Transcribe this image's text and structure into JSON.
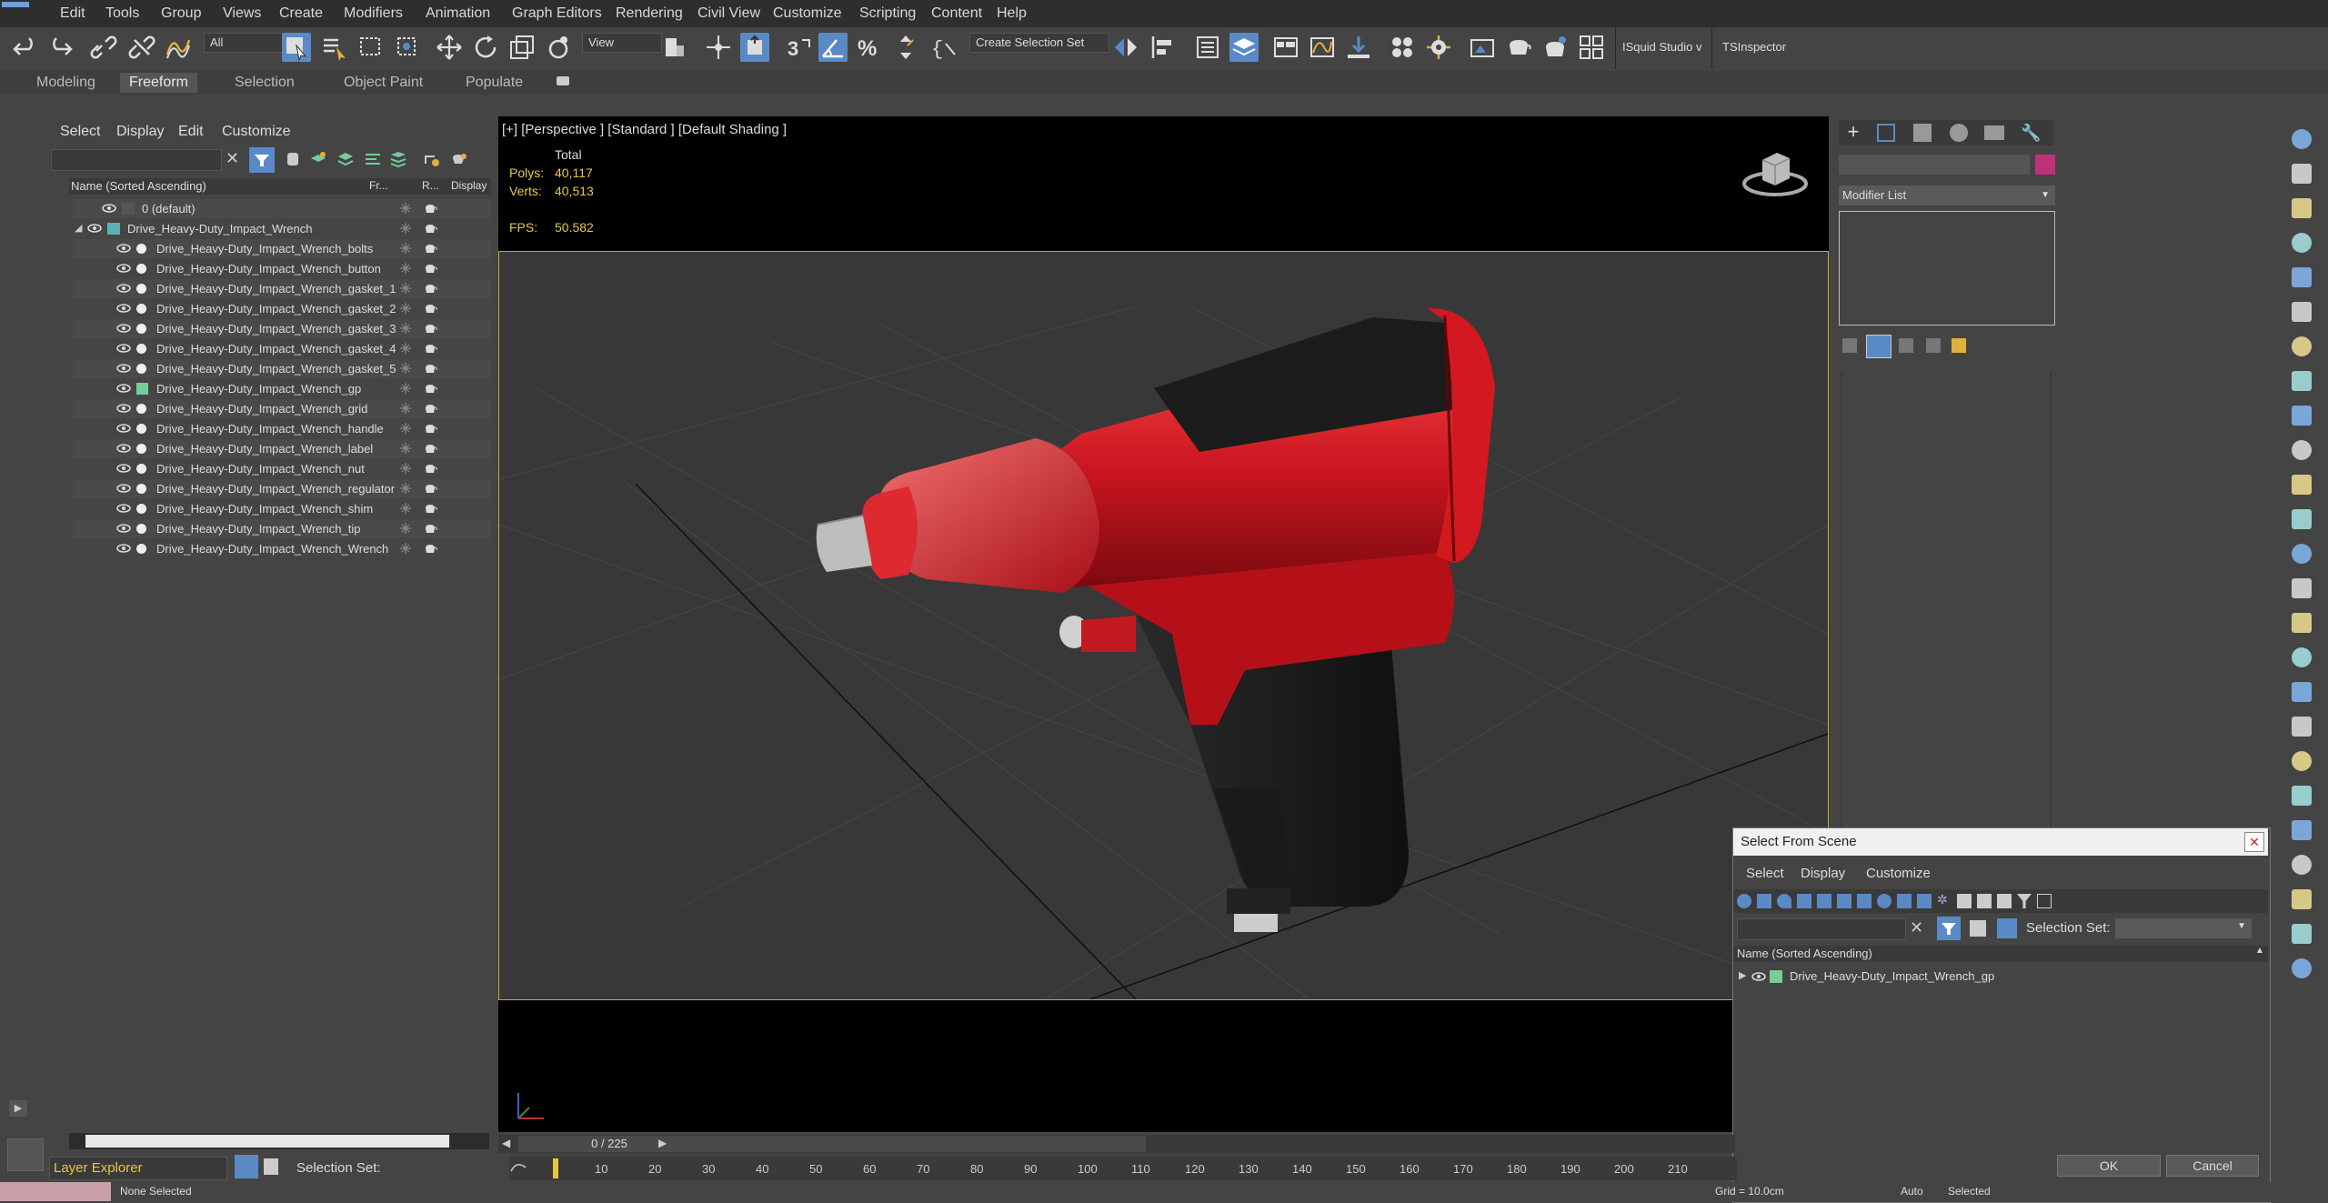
{
  "menubar": {
    "items": [
      "Edit",
      "Tools",
      "Group",
      "Views",
      "Create",
      "Modifiers",
      "Animation",
      "Graph Editors",
      "Rendering",
      "Civil View",
      "Customize",
      "Scripting",
      "Content",
      "Help"
    ]
  },
  "toolbar": {
    "filter_value": "All",
    "refcoord_value": "View",
    "selection_set": "Create Selection Set",
    "plugin_label_1": "ISquid Studio v",
    "plugin_label_2": "TSInspector"
  },
  "ribbon": {
    "tabs": [
      "Modeling",
      "Freeform",
      "Selection",
      "Object Paint",
      "Populate"
    ],
    "active_tab": "Freeform"
  },
  "scene_explorer": {
    "menu": [
      "Select",
      "Display",
      "Edit",
      "Customize"
    ],
    "col_name": "Name (Sorted Ascending)",
    "col_fr": "Fr...",
    "col_r": "R...",
    "col_display": "Display",
    "rows": [
      "0 (default)",
      "Drive_Heavy-Duty_Impact_Wrench",
      "Drive_Heavy-Duty_Impact_Wrench_bolts",
      "Drive_Heavy-Duty_Impact_Wrench_button",
      "Drive_Heavy-Duty_Impact_Wrench_gasket_1",
      "Drive_Heavy-Duty_Impact_Wrench_gasket_2",
      "Drive_Heavy-Duty_Impact_Wrench_gasket_3",
      "Drive_Heavy-Duty_Impact_Wrench_gasket_4",
      "Drive_Heavy-Duty_Impact_Wrench_gasket_5",
      "Drive_Heavy-Duty_Impact_Wrench_gp",
      "Drive_Heavy-Duty_Impact_Wrench_grid",
      "Drive_Heavy-Duty_Impact_Wrench_handle",
      "Drive_Heavy-Duty_Impact_Wrench_label",
      "Drive_Heavy-Duty_Impact_Wrench_nut",
      "Drive_Heavy-Duty_Impact_Wrench_regulator",
      "Drive_Heavy-Duty_Impact_Wrench_shim",
      "Drive_Heavy-Duty_Impact_Wrench_tip",
      "Drive_Heavy-Duty_Impact_Wrench_Wrench"
    ],
    "footer_label": "Layer Explorer",
    "footer_selset": "Selection Set:"
  },
  "viewport": {
    "label": "[+] [Perspective ] [Standard ] [Default Shading ]",
    "stats_header": "Total",
    "polys_label": "Polys:",
    "polys_value": "40,117",
    "verts_label": "Verts:",
    "verts_value": "40,513",
    "fps_label": "FPS:",
    "fps_value": "50.582"
  },
  "command_panel": {
    "modifier_list": "Modifier List",
    "accent_color": "#c0307a"
  },
  "dialog": {
    "title": "Select From Scene",
    "menu": [
      "Select",
      "Display",
      "Customize"
    ],
    "selset_label": "Selection Set:",
    "col_name": "Name (Sorted Ascending)",
    "item": "Drive_Heavy-Duty_Impact_Wrench_gp",
    "ok": "OK",
    "cancel": "Cancel"
  },
  "timeline": {
    "frame": "0 / 225",
    "ticks": [
      "10",
      "20",
      "30",
      "40",
      "50",
      "60",
      "70",
      "80",
      "90",
      "100",
      "110",
      "120",
      "130",
      "140",
      "150",
      "160",
      "170",
      "180",
      "190",
      "200",
      "210"
    ]
  },
  "statusbar": {
    "status": "None Selected",
    "auto": "Auto",
    "selected": "Selected",
    "grid": "Grid = 10.0cm"
  },
  "colors": {
    "wrench_red": "#c8141e",
    "viewport_border": "#c8a62a",
    "active_blue": "#5a8ac6"
  }
}
